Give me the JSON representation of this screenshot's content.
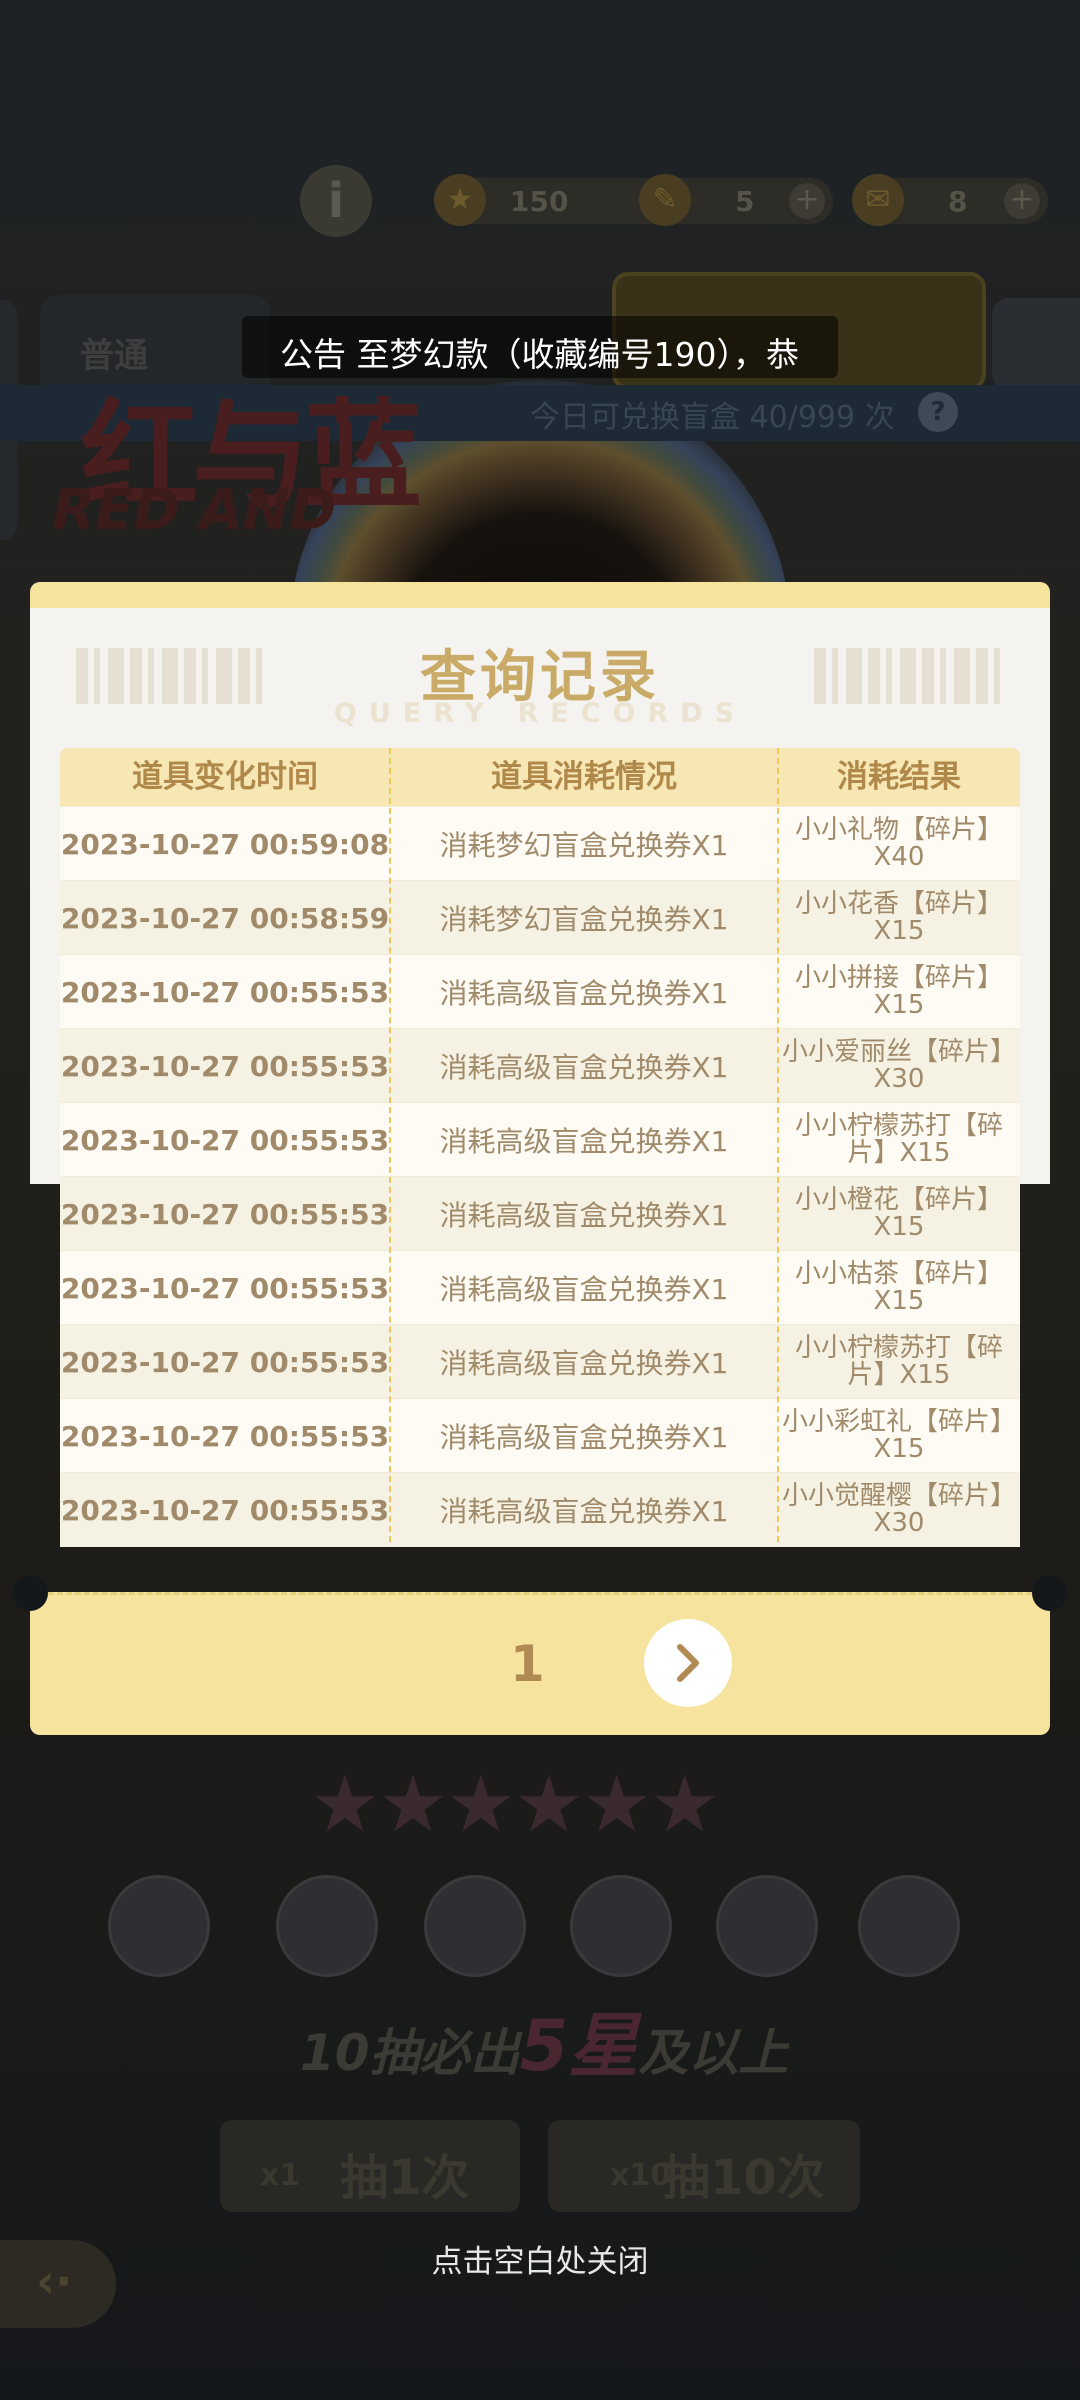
{
  "background": {
    "resources": [
      {
        "icon": "star-coin-icon",
        "value": "150"
      },
      {
        "icon": "feather-icon",
        "value": "5"
      },
      {
        "icon": "ticket-icon",
        "value": "8"
      }
    ],
    "tab_label": "普通",
    "exchange_text": "今日可兑换盲盒 40/999 次",
    "logo_cn": "红与蓝",
    "logo_en": "RED AND",
    "guarantee": {
      "pre": "10",
      "mid": "抽必出",
      "star": "5星",
      "post": "及以上"
    },
    "draw_once": {
      "count": "x1",
      "label": "抽1次"
    },
    "draw_ten": {
      "count": "x10",
      "label": "抽10次"
    }
  },
  "notice": {
    "text": "公告  至梦幻款（收藏编号190），恭"
  },
  "modal": {
    "title": "查询记录",
    "subtitle": "QUERY RECORDS",
    "columns": [
      "道具变化时间",
      "道具消耗情况",
      "消耗结果"
    ],
    "rows": [
      {
        "time": "2023-10-27 00:59:08",
        "cost": "消耗梦幻盲盒兑换券X1",
        "result": "小小礼物【碎片】X40"
      },
      {
        "time": "2023-10-27 00:58:59",
        "cost": "消耗梦幻盲盒兑换券X1",
        "result": "小小花香【碎片】X15"
      },
      {
        "time": "2023-10-27 00:55:53",
        "cost": "消耗高级盲盒兑换券X1",
        "result": "小小拼接【碎片】X15"
      },
      {
        "time": "2023-10-27 00:55:53",
        "cost": "消耗高级盲盒兑换券X1",
        "result": "小小爱丽丝【碎片】X30"
      },
      {
        "time": "2023-10-27 00:55:53",
        "cost": "消耗高级盲盒兑换券X1",
        "result": "小小柠檬苏打【碎片】X15"
      },
      {
        "time": "2023-10-27 00:55:53",
        "cost": "消耗高级盲盒兑换券X1",
        "result": "小小橙花【碎片】X15"
      },
      {
        "time": "2023-10-27 00:55:53",
        "cost": "消耗高级盲盒兑换券X1",
        "result": "小小枯茶【碎片】X15"
      },
      {
        "time": "2023-10-27 00:55:53",
        "cost": "消耗高级盲盒兑换券X1",
        "result": "小小柠檬苏打【碎片】X15"
      },
      {
        "time": "2023-10-27 00:55:53",
        "cost": "消耗高级盲盒兑换券X1",
        "result": "小小彩虹礼【碎片】X15"
      },
      {
        "time": "2023-10-27 00:55:53",
        "cost": "消耗高级盲盒兑换券X1",
        "result": "小小觉醒樱【碎片】X30"
      }
    ],
    "page": "1",
    "next_icon": "chevron-right-icon"
  },
  "close_hint": "点击空白处关闭",
  "colors": {
    "modal_accent": "#f6e49e",
    "title": "#c9aa66",
    "header_text": "#b0884a",
    "cell_text": "#a08a6a"
  }
}
